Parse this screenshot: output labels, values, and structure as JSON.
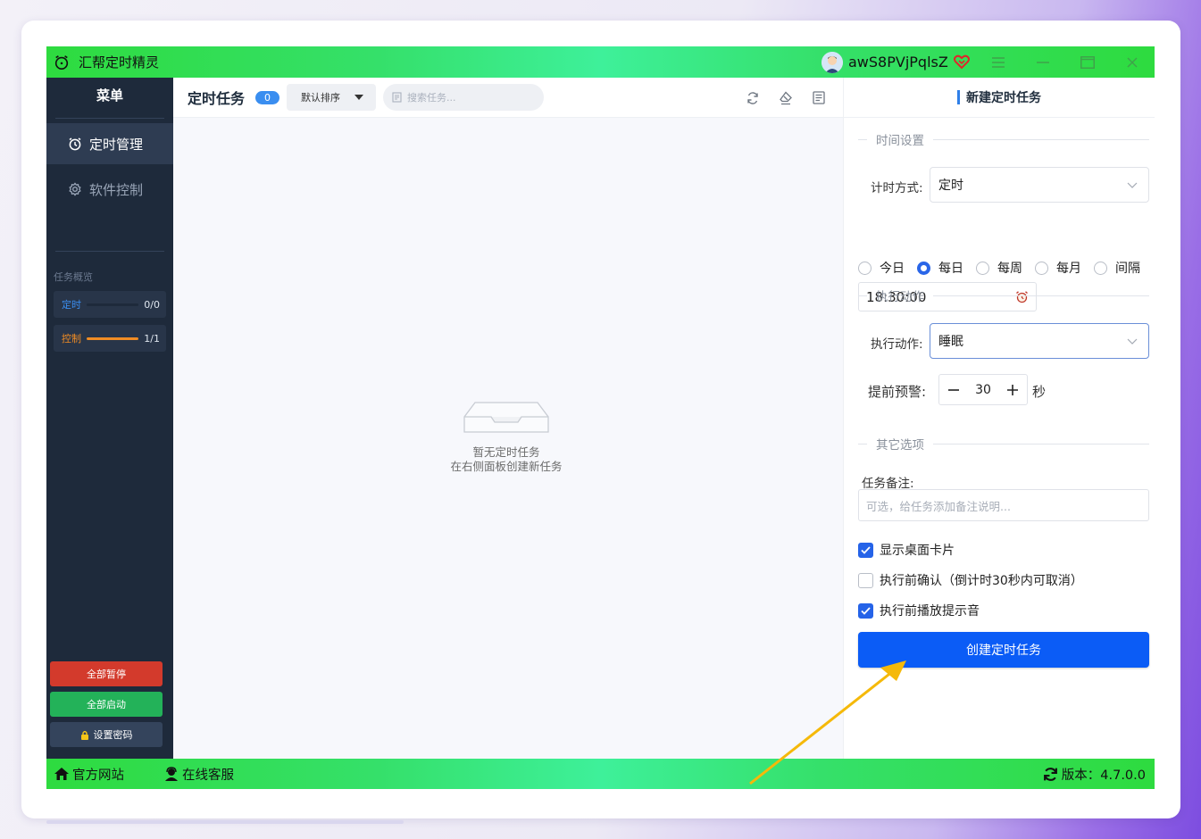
{
  "app": {
    "title": "汇帮定时精灵",
    "username": "awS8PVjPqlsZ"
  },
  "sidebar": {
    "title": "菜单",
    "items": [
      {
        "label": "定时管理",
        "active": true,
        "icon": "alarm-clock-icon"
      },
      {
        "label": "软件控制",
        "active": false,
        "icon": "gear-icon"
      }
    ],
    "overview_title": "任务概览",
    "stats": [
      {
        "label": "定时",
        "count": "0/0",
        "progress": 0,
        "color": "#3a8ef0"
      },
      {
        "label": "控制",
        "count": "1/1",
        "progress": 1,
        "color": "#f08c24"
      }
    ],
    "buttons": {
      "pause_all": "全部暂停",
      "start_all": "全部启动",
      "set_password": "设置密码"
    }
  },
  "main": {
    "title": "定时任务",
    "count_badge": "0",
    "sort_label": "默认排序",
    "search_placeholder": "搜索任务...",
    "empty_line1": "暂无定时任务",
    "empty_line2": "在右侧面板创建新任务"
  },
  "panel": {
    "title": "新建定时任务",
    "section_time": "时间设置",
    "timing_mode_label": "计时方式:",
    "timing_mode_value": "定时",
    "radios": [
      {
        "label": "今日",
        "checked": false
      },
      {
        "label": "每日",
        "checked": true
      },
      {
        "label": "每周",
        "checked": false
      },
      {
        "label": "每月",
        "checked": false
      },
      {
        "label": "间隔",
        "checked": false
      }
    ],
    "time_value": "18:30:00",
    "section_action": "执行动作",
    "action_label": "执行动作:",
    "action_value": "睡眠",
    "warn_label": "提前预警:",
    "warn_value": "30",
    "warn_unit": "秒",
    "section_other": "其它选项",
    "note_label": "任务备注:",
    "note_placeholder": "可选，给任务添加备注说明...",
    "checkboxes": [
      {
        "label": "显示桌面卡片",
        "checked": true
      },
      {
        "label": "执行前确认（倒计时30秒内可取消）",
        "checked": false
      },
      {
        "label": "执行前播放提示音",
        "checked": true
      }
    ],
    "create_button": "创建定时任务"
  },
  "footer": {
    "website": "官方网站",
    "support": "在线客服",
    "version": "版本：4.7.0.0"
  },
  "colors": {
    "accent": "#0b5cf6",
    "titlebar_green": "#2edb3f",
    "sidebar_bg": "#1e2a3b",
    "arrow": "#f5b90a"
  }
}
